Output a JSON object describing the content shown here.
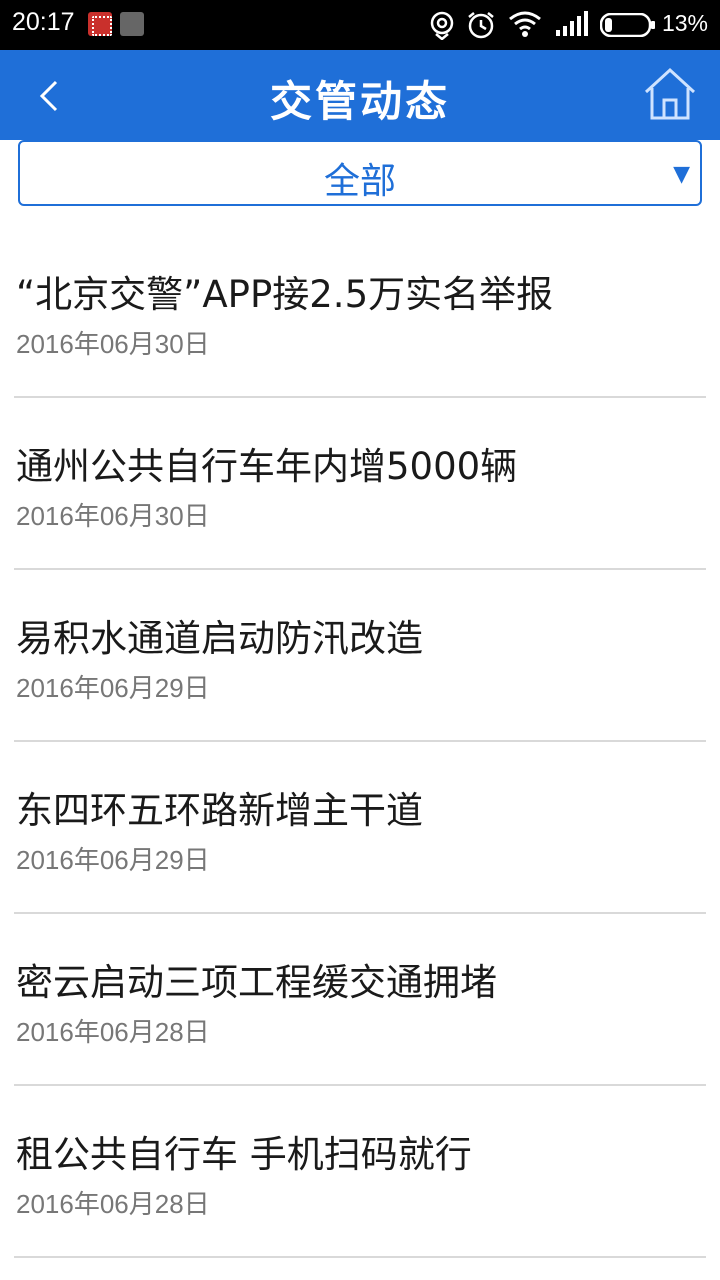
{
  "status_bar": {
    "time": "20:17",
    "battery_percent": "13%",
    "icons": [
      "app-notification-icon",
      "app-notification-icon",
      "sync-icon",
      "alarm-icon",
      "wifi-icon",
      "signal-icon",
      "battery-icon"
    ]
  },
  "header": {
    "title": "交管动态",
    "back_icon": "chevron-left-icon",
    "home_icon": "home-icon",
    "background_color": "#1f6fd8"
  },
  "filter": {
    "selected": "全部"
  },
  "news": [
    {
      "title": "“北京交警”APP接2.5万实名举报",
      "date": "2016年06月30日"
    },
    {
      "title": "通州公共自行车年内增5000辆",
      "date": "2016年06月30日"
    },
    {
      "title": "易积水通道启动防汛改造",
      "date": "2016年06月29日"
    },
    {
      "title": "东四环五环路新增主干道",
      "date": "2016年06月29日"
    },
    {
      "title": "密云启动三项工程缓交通拥堵",
      "date": "2016年06月28日"
    },
    {
      "title": "租公共自行车 手机扫码就行",
      "date": "2016年06月28日"
    }
  ]
}
